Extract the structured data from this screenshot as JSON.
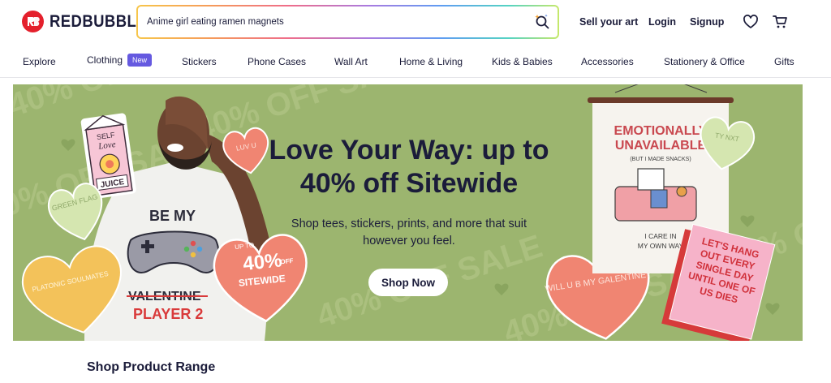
{
  "brand": {
    "name": "REDBUBBLE"
  },
  "search": {
    "value": "Anime girl eating ramen magnets"
  },
  "header": {
    "sell_label": "Sell your art",
    "login_label": "Login",
    "signup_label": "Signup",
    "wishlist_icon": "heart-icon",
    "cart_icon": "cart-icon"
  },
  "nav": {
    "items": [
      {
        "label": "Explore"
      },
      {
        "label": "Clothing",
        "badge": "New"
      },
      {
        "label": "Stickers"
      },
      {
        "label": "Phone Cases"
      },
      {
        "label": "Wall Art"
      },
      {
        "label": "Home & Living"
      },
      {
        "label": "Kids & Babies"
      },
      {
        "label": "Accessories"
      },
      {
        "label": "Stationery & Office"
      },
      {
        "label": "Gifts"
      }
    ]
  },
  "hero": {
    "title": "Love Your Way: up to 40% off Sitewide",
    "subtitle": "Shop tees, stickers, prints, and more that suit however you feel.",
    "cta_label": "Shop Now",
    "background_color": "#9cb56f",
    "watermark_text": "40% OFF SALE",
    "hearts": {
      "luv_u": "LUV U",
      "green_flag": "GREEN FLAG",
      "platonic": "PLATONIC SOULMATES",
      "sale_up_to": "UP TO",
      "sale_percent": "40%",
      "sale_off": "OFF",
      "sale_sitewide": "SITEWIDE",
      "galentine": "WILL U B MY GALENTINE?",
      "ty_nxt": "TY NXT"
    },
    "shirt": {
      "line1": "BE MY",
      "line2": "VALENTINE",
      "line3": "PLAYER 2"
    },
    "sticker_milk": {
      "line1": "SELF",
      "line2": "Love",
      "line3": "JUICE"
    },
    "poster": {
      "line1": "EMOTIONALLY",
      "line2": "UNAVAILABLE",
      "line3": "(BUT I MADE SNACKS)",
      "line4": "I CARE IN",
      "line5": "MY OWN WAY"
    },
    "card": "LET'S HANG OUT EVERY SINGLE DAY UNTIL ONE OF US DIES"
  },
  "section": {
    "title": "Shop Product Range"
  }
}
